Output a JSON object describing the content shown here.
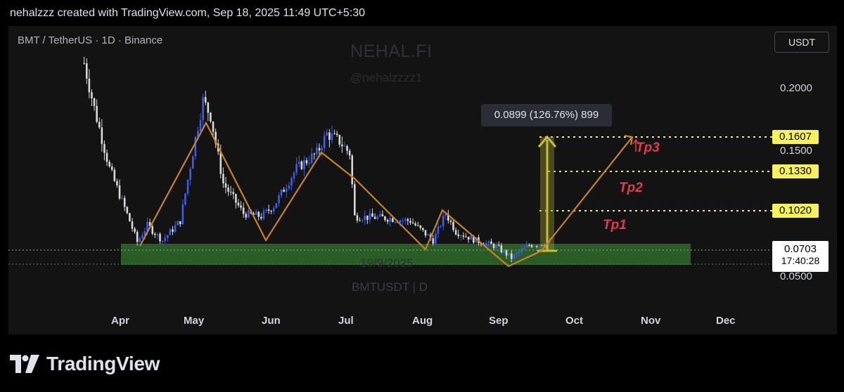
{
  "header": {
    "caption": "nehalzzz created with TradingView.com, Sep 18, 2025 11:49 UTC+5:30"
  },
  "chart": {
    "symbol_title": "BMT / TetherUS · 1D · Binance",
    "currency_button": "USDT",
    "watermark": {
      "brand": "NEHAL.FI",
      "handle": "@nehalzzzz1",
      "date": "19/9/2025",
      "symbol": "BMTUSDT | D"
    },
    "measure_label": "0.0899 (126.76%) 899",
    "last_price": {
      "value": "0.0703",
      "countdown": "17:40:28"
    },
    "targets": [
      {
        "name": "Tp1",
        "price": "0.1020"
      },
      {
        "name": "Tp2",
        "price": "0.1330"
      },
      {
        "name": "Tp3",
        "price": "0.1607"
      }
    ],
    "y_ticks": [
      "0.2000",
      "0.1500",
      "0.0500"
    ],
    "x_ticks": [
      "Apr",
      "May",
      "Jun",
      "Jul",
      "Aug",
      "Sep",
      "Oct",
      "Nov",
      "Dec"
    ],
    "colors": {
      "bullish": "#3d5ee8",
      "bearish": "#d8d8d8",
      "pattern_line": "#c8822a",
      "target_line": "#f7f15b",
      "support_zone": "#2f6b2a",
      "tp_label": "#e23a4e",
      "measure_arrow": "#c9bd3a"
    }
  },
  "chart_data": {
    "type": "candlestick",
    "title": "BMT / TetherUS · 1D · Binance",
    "x_axis": [
      "Apr",
      "May",
      "Jun",
      "Jul",
      "Aug",
      "Sep",
      "Oct",
      "Nov",
      "Dec"
    ],
    "y_axis_ticks": [
      0.2,
      0.15,
      0.05
    ],
    "approx_close_path": [
      {
        "x": "Mar 18",
        "y": 0.19
      },
      {
        "x": "Mar 22",
        "y": 0.16
      },
      {
        "x": "Mar 28",
        "y": 0.12
      },
      {
        "x": "Apr 5",
        "y": 0.085
      },
      {
        "x": "Apr 8",
        "y": 0.071
      },
      {
        "x": "Apr 12",
        "y": 0.082
      },
      {
        "x": "Apr 18",
        "y": 0.072
      },
      {
        "x": "Apr 25",
        "y": 0.085
      },
      {
        "x": "May 1",
        "y": 0.14
      },
      {
        "x": "May 4",
        "y": 0.165
      },
      {
        "x": "May 7",
        "y": 0.155
      },
      {
        "x": "May 12",
        "y": 0.11
      },
      {
        "x": "May 20",
        "y": 0.09
      },
      {
        "x": "May 27",
        "y": 0.088
      },
      {
        "x": "Jun 1",
        "y": 0.095
      },
      {
        "x": "Jun 10",
        "y": 0.12
      },
      {
        "x": "Jun 18",
        "y": 0.13
      },
      {
        "x": "Jun 22",
        "y": 0.143
      },
      {
        "x": "Jun 27",
        "y": 0.138
      },
      {
        "x": "Jul 1",
        "y": 0.13
      },
      {
        "x": "Jul 3",
        "y": 0.088
      },
      {
        "x": "Jul 15",
        "y": 0.087
      },
      {
        "x": "Jul 25",
        "y": 0.085
      },
      {
        "x": "Aug 3",
        "y": 0.072
      },
      {
        "x": "Aug 8",
        "y": 0.09
      },
      {
        "x": "Aug 12",
        "y": 0.078
      },
      {
        "x": "Aug 20",
        "y": 0.072
      },
      {
        "x": "Aug 28",
        "y": 0.068
      },
      {
        "x": "Sep 3",
        "y": 0.0605
      },
      {
        "x": "Sep 10",
        "y": 0.069
      },
      {
        "x": "Sep 18",
        "y": 0.0703
      }
    ],
    "support_zone": [
      0.059,
      0.072
    ],
    "targets": [
      {
        "name": "Tp1",
        "value": 0.102
      },
      {
        "name": "Tp2",
        "value": 0.133
      },
      {
        "name": "Tp3",
        "value": 0.1607
      }
    ],
    "projection": {
      "change": 0.0899,
      "percent": 126.76,
      "ticks": 899
    },
    "last_price": 0.0703,
    "grid": false
  }
}
